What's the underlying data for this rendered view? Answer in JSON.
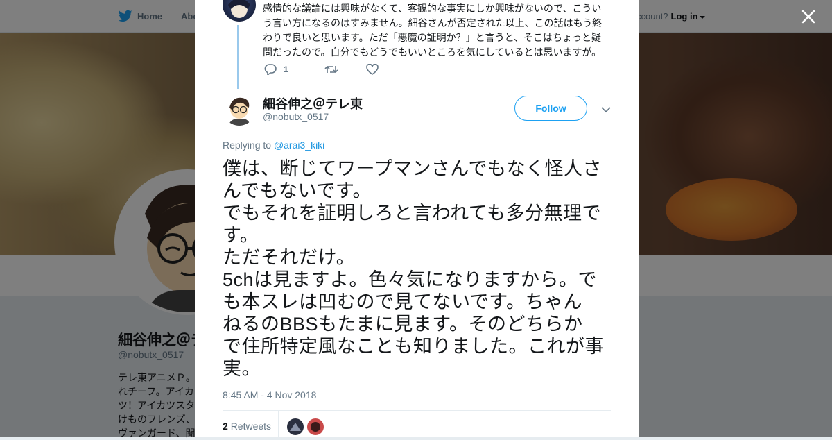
{
  "nav": {
    "home_label": "Home",
    "about_label": "Abo",
    "account_prompt": "ccount?",
    "login_label": "Log in"
  },
  "profile": {
    "name": "細谷伸之＠テ",
    "handle": "@nobutx_0517",
    "bio_lines": [
      "テレ東アニメＰ。",
      "れチーフ。アイカ",
      "ツ！アイカツスタ",
      "けものフレンズ、",
      "ヴァンガード、闇"
    ]
  },
  "prev_tweet": {
    "text": "感情的な議論には興味がなくて、客観的な事実にしか興味がないので、こういう言い方になるのはすみません。細谷さんが否定された以上、この話はもう終わりで良いと思います。ただ「悪魔の証明か？」と言うと、そこはちょっと疑問だったので。自分でもどうでもいいところを気にしているとは思いますが。",
    "reply_count": "1"
  },
  "tweet": {
    "author_name": "細谷伸之＠テレ東",
    "author_handle": "@nobutx_0517",
    "follow_label": "Follow",
    "replying_to_label": "Replying to",
    "replying_to_handle": "@arai3_kiki",
    "lines": [
      "僕は、断じてワープマンさんでもなく怪人さ",
      "んでもないです。",
      "でもそれを証明しろと言われても多分無理で",
      "す。",
      "ただそれだけ。",
      "5chは見ますよ。色々気になりますから。で",
      "も本スレは凹むので見てないです。ちゃん",
      "ねるのBBSもたまに見ます。そのどちらか",
      "で住所特定風なことも知りました。これが事",
      "実。"
    ],
    "timestamp": "8:45 AM - 4 Nov 2018",
    "retweet_count": "2",
    "retweets_label": "Retweets"
  },
  "colors": {
    "accent": "#1da1f2",
    "thread_line": "#9ac9ec",
    "muted": "#657786"
  }
}
